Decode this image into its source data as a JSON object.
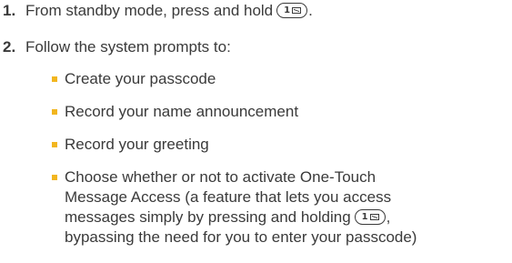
{
  "steps": [
    {
      "number": "1.",
      "text": "From standby mode, press and hold",
      "key_label": "1",
      "suffix": "."
    },
    {
      "number": "2.",
      "text": "Follow the system prompts to:"
    }
  ],
  "bullets": [
    "Create your passcode",
    "Record your name announcement",
    "Record your greeting"
  ],
  "last_bullet": {
    "line1": "Choose whether or not to activate One-Touch",
    "line2": "Message Access (a feature that lets you access",
    "line3_pre": "messages simply by pressing and holding",
    "line3_post": ",",
    "line4": "bypassing the need for you to enter your passcode)",
    "key_label": "1"
  },
  "colors": {
    "bullet": "#f2b61f",
    "step_number": "#3a3a3a"
  },
  "icons": {
    "key": "key-1-voicemail-icon",
    "bullet": "square-bullet-icon"
  }
}
